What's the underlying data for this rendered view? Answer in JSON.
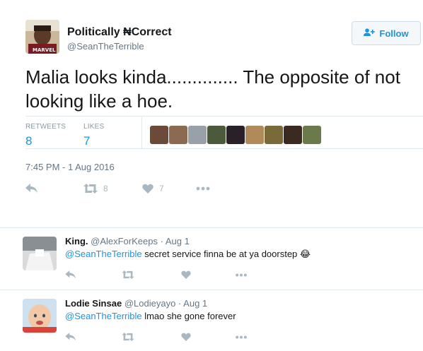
{
  "main_tweet": {
    "display_name": "Politically ₦Correct",
    "screen_name": "@SeanTheTerrible",
    "follow_label": "Follow",
    "text": "Malia looks kinda.............. The opposite of not looking like a hoe.",
    "retweets_label": "RETWEETS",
    "retweets_count": "8",
    "likes_label": "LIKES",
    "likes_count": "7",
    "timestamp": "7:45 PM - 1 Aug 2016",
    "action_retweet_count": "8",
    "action_like_count": "7",
    "liker_colors": [
      "#6b4a3a",
      "#8a6a50",
      "#9aa0a8",
      "#4a5a3a",
      "#2a2028",
      "#b08a5a",
      "#7a6a3a",
      "#3a2a22",
      "#6a7a4a"
    ]
  },
  "replies": [
    {
      "name": "King.",
      "handle": "@AlexForKeeps",
      "dot": "·",
      "date": "Aug 1",
      "mention": "@SeanTheTerrible",
      "text": "secret service finna be at ya doorstep",
      "emoji": "😂"
    },
    {
      "name": "Lodie Sinsae",
      "handle": "@Lodieyayo",
      "dot": "·",
      "date": "Aug 1",
      "mention": "@SeanTheTerrible",
      "text": "lmao she gone forever"
    }
  ],
  "icons": {
    "reply": "reply-icon",
    "retweet": "retweet-icon",
    "like": "heart-icon",
    "more": "more-icon",
    "follow": "add-user-icon"
  },
  "colors": {
    "link": "#1b95e0",
    "muted": "#657786",
    "icon": "#aab8c2",
    "border": "#e1e8ed"
  }
}
